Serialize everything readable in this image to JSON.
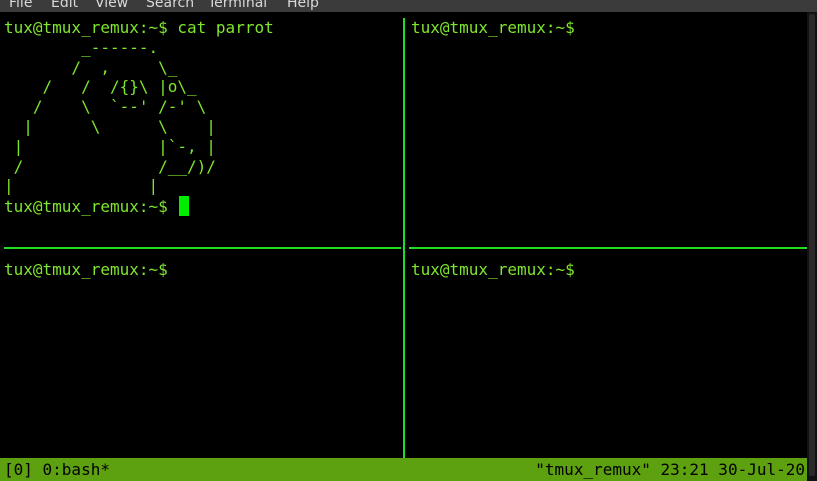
{
  "menubar": {
    "items": [
      "File",
      "Edit",
      "View",
      "Search",
      "Terminal",
      "Help"
    ]
  },
  "panes": {
    "top_left": {
      "command_line": "tux@tmux_remux:~$ cat parrot",
      "ascii_art": "        _------.\n       /  ,     \\_\n    /   /  /{}\\ |o\\_\n   /    \\  `--' /-' \\\n  |      \\      \\    |\n |              |`-, |\n /              /__/)/\n|              |",
      "prompt": "tux@tmux_remux:~$ "
    },
    "top_right": {
      "prompt": "tux@tmux_remux:~$"
    },
    "bottom_left": {
      "prompt": "tux@tmux_remux:~$"
    },
    "bottom_right": {
      "prompt": "tux@tmux_remux:~$"
    }
  },
  "statusbar": {
    "left": "[0] 0:bash*",
    "right": "\"tmux_remux\" 23:21 30-Jul-20"
  },
  "colors": {
    "prompt_text": "#7ee62c",
    "pane_border": "#22dd22",
    "cursor": "#00ee00",
    "statusbar_bg": "#5da010"
  }
}
